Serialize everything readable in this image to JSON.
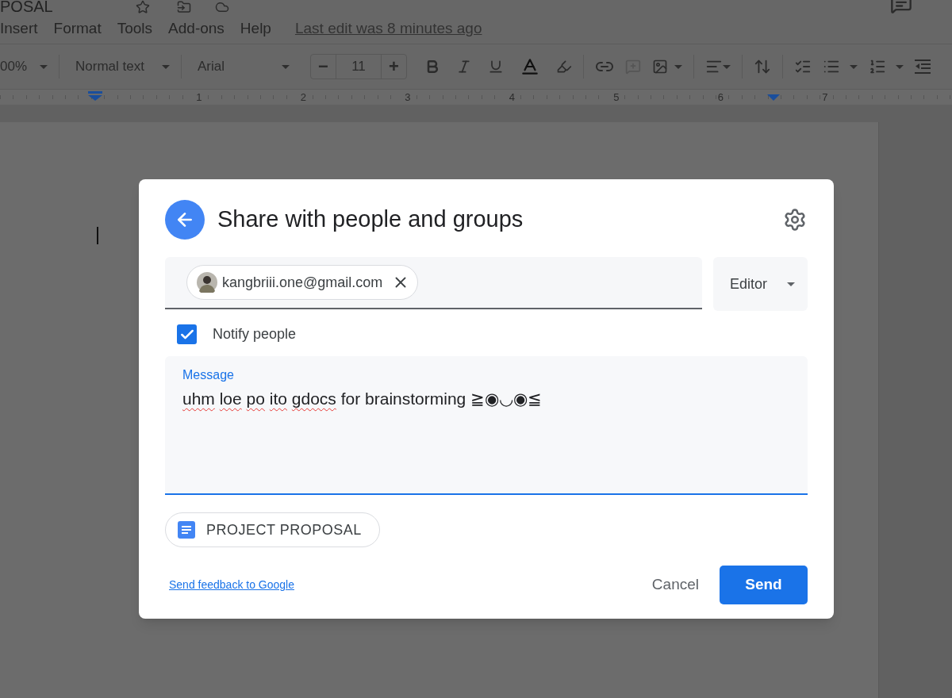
{
  "doc": {
    "title": "POSAL",
    "menu": [
      "Insert",
      "Format",
      "Tools",
      "Add-ons",
      "Help"
    ],
    "last_edit": "Last edit was 8 minutes ago",
    "toolbar": {
      "zoom": "00%",
      "style": "Normal text",
      "font": "Arial",
      "minus": "−",
      "font_size": "11",
      "plus": "+"
    },
    "ruler": [
      "1",
      "2",
      "3",
      "4",
      "5",
      "6",
      "7"
    ]
  },
  "dialog": {
    "title": "Share with people and groups",
    "recipients": [
      {
        "email": "kangbriii.one@gmail.com"
      }
    ],
    "role": "Editor",
    "notify": {
      "label": "Notify people",
      "checked": true
    },
    "message": {
      "label": "Message",
      "words": [
        {
          "text": "uhm",
          "misspelled": true
        },
        {
          "text": "loe",
          "misspelled": true
        },
        {
          "text": "po",
          "misspelled": true
        },
        {
          "text": "ito",
          "misspelled": true
        },
        {
          "text": "gdocs",
          "misspelled": true
        },
        {
          "text": "for",
          "misspelled": false
        },
        {
          "text": "brainstorming",
          "misspelled": false
        },
        {
          "text": "≧◉◡◉≦",
          "misspelled": false
        }
      ]
    },
    "attachment": "PROJECT PROPOSAL",
    "feedback_link": "Send feedback to Google",
    "cancel": "Cancel",
    "send": "Send"
  }
}
